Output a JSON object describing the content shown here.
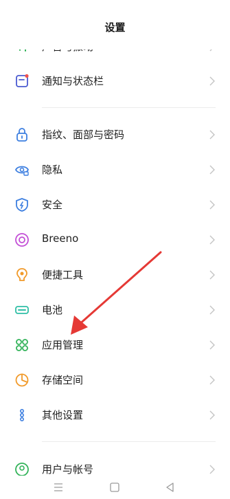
{
  "header": {
    "title": "设置"
  },
  "items": [
    {
      "label": "声音与振动",
      "icon": "sound-icon",
      "color": "#33b35a"
    },
    {
      "label": "通知与状态栏",
      "icon": "notification-icon",
      "color": "#4a5ad1"
    },
    {
      "label": "指纹、面部与密码",
      "icon": "lock-icon",
      "color": "#3d7fe0"
    },
    {
      "label": "隐私",
      "icon": "privacy-eye-icon",
      "color": "#3d7fe0"
    },
    {
      "label": "安全",
      "icon": "shield-icon",
      "color": "#3d7fe0"
    },
    {
      "label": "Breeno",
      "icon": "breeno-icon",
      "color": "#c34fd6"
    },
    {
      "label": "便捷工具",
      "icon": "convenience-tool-icon",
      "color": "#f19a2a"
    },
    {
      "label": "电池",
      "icon": "battery-icon",
      "color": "#2fbfa6"
    },
    {
      "label": "应用管理",
      "icon": "app-grid-icon",
      "color": "#33b35a"
    },
    {
      "label": "存储空间",
      "icon": "storage-pie-icon",
      "color": "#f19a2a"
    },
    {
      "label": "其他设置",
      "icon": "more-settings-icon",
      "color": "#3d7fe0"
    },
    {
      "label": "用户与帐号",
      "icon": "user-icon",
      "color": "#33b35a"
    }
  ],
  "navbar": {
    "buttons": [
      "menu-icon",
      "home-icon",
      "back-icon"
    ]
  },
  "annotation": {
    "type": "red-arrow",
    "points_to": "应用管理"
  }
}
